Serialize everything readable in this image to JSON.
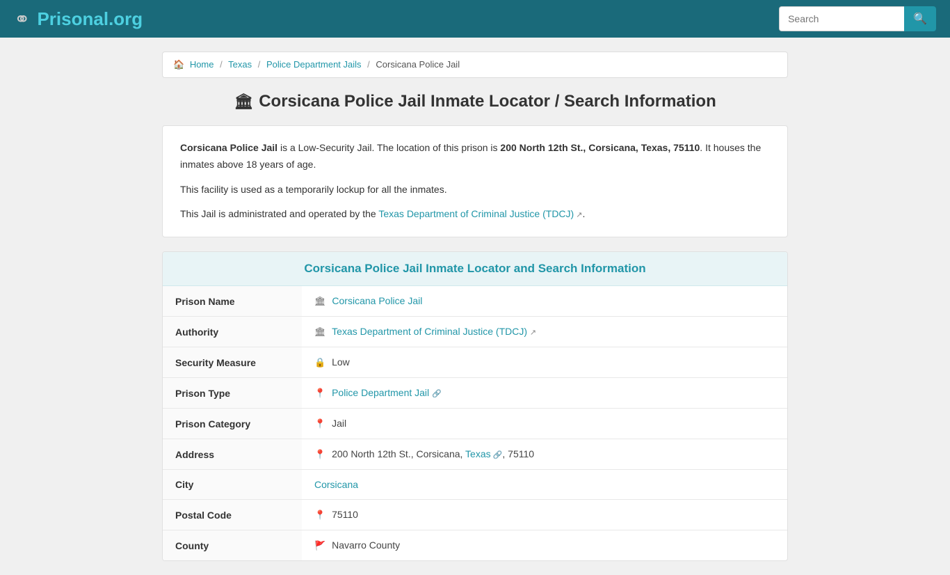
{
  "header": {
    "logo_text": "Prisonal",
    "logo_tld": ".org",
    "search_placeholder": "Search"
  },
  "breadcrumb": {
    "home_label": "Home",
    "items": [
      {
        "label": "Texas",
        "href": "#"
      },
      {
        "label": "Police Department Jails",
        "href": "#"
      },
      {
        "label": "Corsicana Police Jail",
        "href": "#"
      }
    ]
  },
  "page": {
    "title": "Corsicana Police Jail Inmate Locator / Search Information",
    "description_1_prefix": "Corsicana Police Jail",
    "description_1_body": " is a Low-Security Jail. The location of this prison is ",
    "description_1_address": "200 North 12th St., Corsicana, Texas, 75110",
    "description_1_suffix": ". It houses the inmates above 18 years of age.",
    "description_2": "This facility is used as a temporarily lockup for all the inmates.",
    "description_3_prefix": "This Jail is administrated and operated by the ",
    "description_3_link": "Texas Department of Criminal Justice (TDCJ)",
    "description_3_suffix": "."
  },
  "table_section": {
    "header": "Corsicana Police Jail Inmate Locator and Search Information",
    "rows": [
      {
        "label": "Prison Name",
        "icon": "🏛",
        "value": "Corsicana Police Jail",
        "is_link": true,
        "href": "#"
      },
      {
        "label": "Authority",
        "icon": "🏛",
        "value": "Texas Department of Criminal Justice (TDCJ)",
        "is_link": true,
        "href": "#",
        "has_ext": true
      },
      {
        "label": "Security Measure",
        "icon": "🔒",
        "value": "Low",
        "is_link": false
      },
      {
        "label": "Prison Type",
        "icon": "📍",
        "value": "Police Department Jail",
        "is_link": true,
        "href": "#",
        "has_link_icon": true
      },
      {
        "label": "Prison Category",
        "icon": "📍",
        "value": "Jail",
        "is_link": false
      },
      {
        "label": "Address",
        "icon": "📍",
        "value_prefix": "200 North 12th St., Corsicana, ",
        "value_link": "Texas",
        "value_suffix": ", 75110",
        "is_address": true
      },
      {
        "label": "City",
        "icon": "",
        "value": "Corsicana",
        "is_link": true,
        "href": "#"
      },
      {
        "label": "Postal Code",
        "icon": "📍",
        "value": "75110",
        "is_link": false
      },
      {
        "label": "County",
        "icon": "🚩",
        "value": "Navarro County",
        "is_link": false
      }
    ]
  }
}
